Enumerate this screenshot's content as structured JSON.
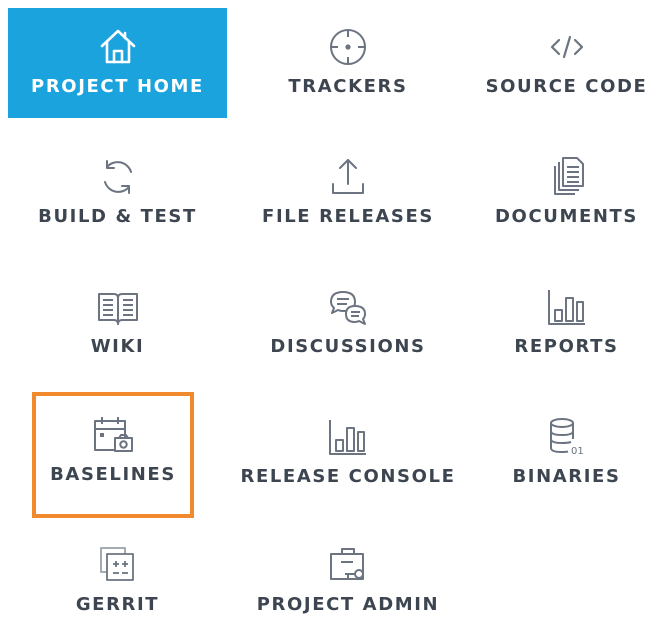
{
  "nav": {
    "items": [
      {
        "label": "PROJECT HOME",
        "icon": "home-icon",
        "active": true
      },
      {
        "label": "TRACKERS",
        "icon": "crosshair-icon"
      },
      {
        "label": "SOURCE CODE",
        "icon": "code-icon"
      },
      {
        "label": "BUILD & TEST",
        "icon": "refresh-icon"
      },
      {
        "label": "FILE RELEASES",
        "icon": "upload-icon"
      },
      {
        "label": "DOCUMENTS",
        "icon": "documents-icon"
      },
      {
        "label": "WIKI",
        "icon": "book-icon"
      },
      {
        "label": "DISCUSSIONS",
        "icon": "chat-bubbles-icon"
      },
      {
        "label": "REPORTS",
        "icon": "bar-chart-icon"
      },
      {
        "label": "BASELINES",
        "icon": "calendar-camera-icon",
        "highlighted": true
      },
      {
        "label": "RELEASE CONSOLE",
        "icon": "bar-chart-icon"
      },
      {
        "label": "BINARIES",
        "icon": "database-binary-icon"
      },
      {
        "label": "GERRIT",
        "icon": "gerrit-icon"
      },
      {
        "label": "PROJECT ADMIN",
        "icon": "briefcase-key-icon"
      }
    ]
  },
  "colors": {
    "active_background": "#1aa3dd",
    "highlight_border": "#f08a2c",
    "text": "#3d4650",
    "icon": "#6b7480"
  }
}
